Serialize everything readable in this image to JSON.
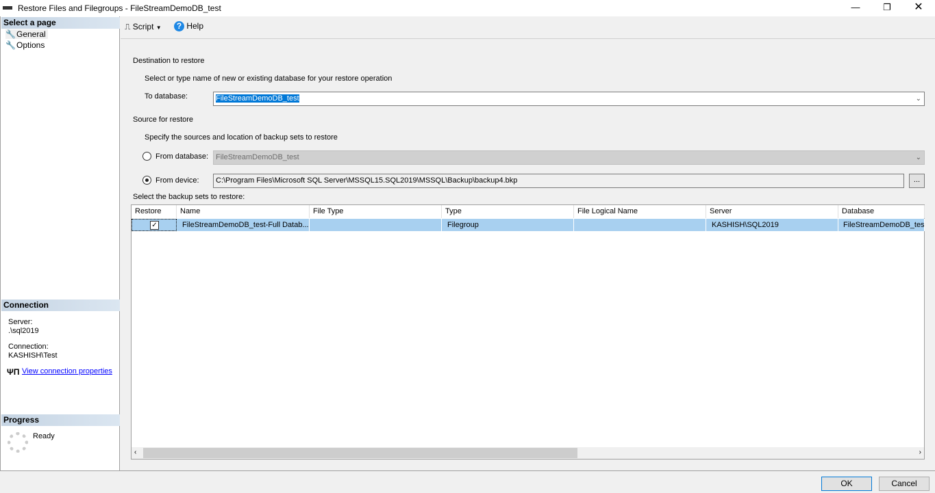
{
  "window": {
    "title": "Restore Files and Filegroups - FileStreamDemoDB_test"
  },
  "sidebar": {
    "select_page": "Select a page",
    "items": [
      {
        "label": "General"
      },
      {
        "label": "Options"
      }
    ],
    "connection_header": "Connection",
    "server_label": "Server:",
    "server_value": ".\\sql2019",
    "connection_label": "Connection:",
    "connection_value": "KASHISH\\Test",
    "view_props": "View connection properties",
    "progress_header": "Progress",
    "progress_status": "Ready"
  },
  "toolbar": {
    "script": "Script",
    "help": "Help"
  },
  "dest": {
    "heading": "Destination to restore",
    "hint": "Select or type name of new or existing database for your restore operation",
    "to_db_label": "To database:",
    "to_db_value": "FileStreamDemoDB_test"
  },
  "source": {
    "heading": "Source for restore",
    "hint": "Specify the sources and location of backup sets to restore",
    "from_db_label": "From database:",
    "from_db_value": "FileStreamDemoDB_test",
    "from_device_label": "From device:",
    "from_device_value": "C:\\Program Files\\Microsoft SQL Server\\MSSQL15.SQL2019\\MSSQL\\Backup\\backup4.bkp",
    "browse": "..."
  },
  "backup_sets": {
    "label": "Select the backup sets to restore:",
    "columns": [
      "Restore",
      "Name",
      "File Type",
      "Type",
      "File Logical Name",
      "Server",
      "Database"
    ],
    "rows": [
      {
        "restore": true,
        "name": "FileStreamDemoDB_test-Full Datab...",
        "file_type": "",
        "type": "Filegroup",
        "file_logical_name": "",
        "server": "KASHISH\\SQL2019",
        "database": "FileStreamDemoDB_test"
      }
    ]
  },
  "footer": {
    "ok": "OK",
    "cancel": "Cancel"
  }
}
